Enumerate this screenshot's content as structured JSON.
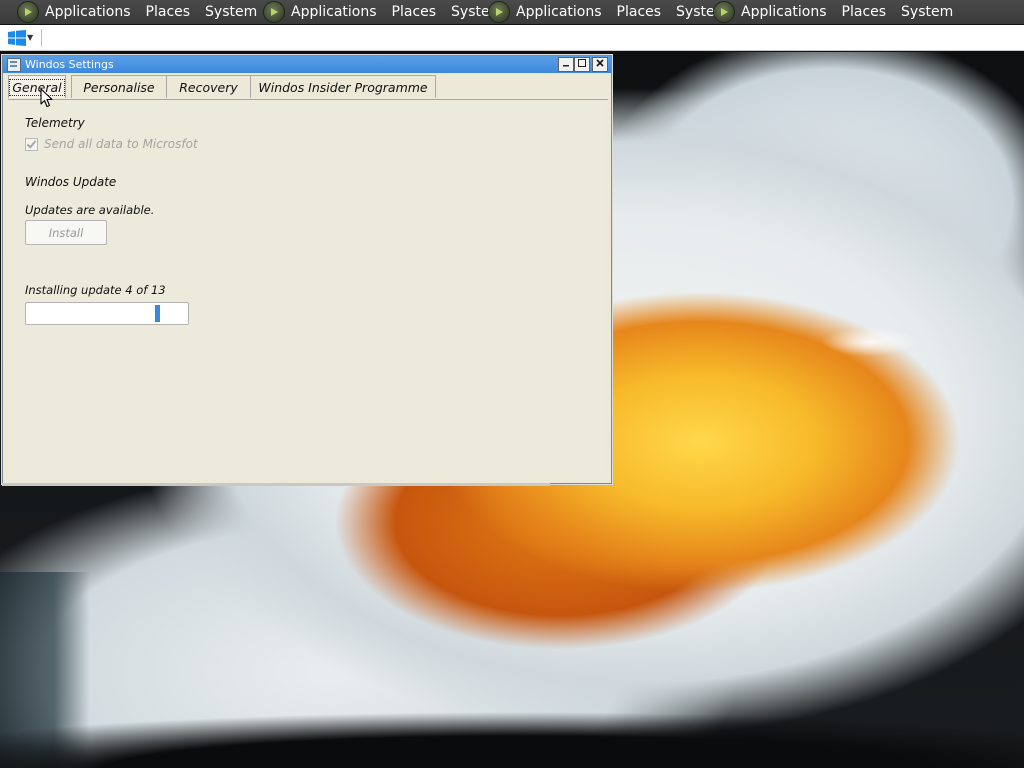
{
  "top_panel": {
    "groups": [
      {
        "applications": "Applications",
        "places": "Places",
        "system": "System"
      },
      {
        "applications": "Applications",
        "places": "Places",
        "system": "System"
      },
      {
        "applications": "Applications",
        "places": "Places",
        "system": "System"
      },
      {
        "applications": "Applications",
        "places": "Places",
        "system": "System"
      }
    ],
    "logo_icon": "gnome-foot-icon"
  },
  "taskbar": {
    "start_icon": "windows-logo-icon",
    "start_color": "#1e88e5"
  },
  "window": {
    "title": "Windos Settings",
    "title_bar_color": "#3c88dd",
    "tabs": [
      {
        "label": "General",
        "active": true
      },
      {
        "label": "Personalise",
        "active": false
      },
      {
        "label": "Recovery",
        "active": false
      },
      {
        "label": "Windos Insider Programme",
        "active": false
      }
    ],
    "telemetry": {
      "heading": "Telemetry",
      "checkbox_label": "Send all data to Microsfot",
      "checked": true,
      "disabled": true
    },
    "update": {
      "heading": "Windos Update",
      "status": "Updates are available.",
      "install_label": "Install",
      "install_disabled": true,
      "progress_label": "Installing update 4 of 13",
      "progress_fraction": 0.82
    },
    "accent_color": "#3a87dd"
  }
}
